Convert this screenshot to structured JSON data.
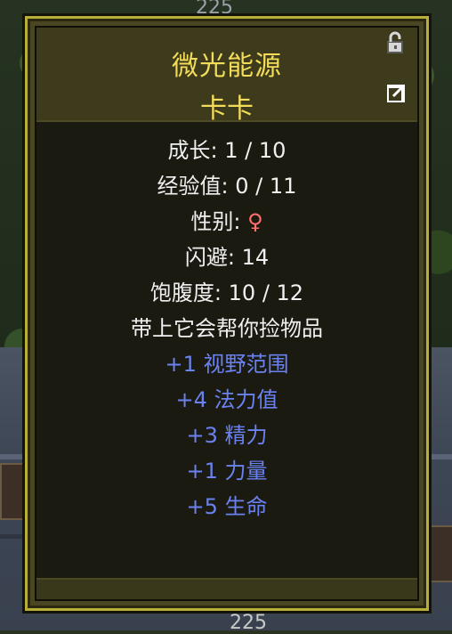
{
  "background": {
    "top_number": "225",
    "bottom_number": "225"
  },
  "tooltip": {
    "title": "微光能源",
    "subtitle": "卡卡",
    "icons": {
      "lock": "lock-icon",
      "share": "share-icon"
    },
    "stats": [
      {
        "label": "成长:",
        "value": "1 / 10"
      },
      {
        "label": "经验值:",
        "value": "0 / 11"
      },
      {
        "label": "性别:",
        "value": "♀"
      },
      {
        "label": "闪避:",
        "value": "14"
      },
      {
        "label": "饱腹度:",
        "value": "10 / 12"
      }
    ],
    "description": "带上它会帮你捡物品",
    "bonuses": [
      "+1 视野范围",
      "+4 法力值",
      "+3 精力",
      "+1 力量",
      "+5 生命"
    ]
  },
  "colors": {
    "title": "#f2dc5a",
    "text": "#f0f0f0",
    "female": "#ff6f6f",
    "bonus": "#6a82f0",
    "border": "#b8ae3a"
  }
}
